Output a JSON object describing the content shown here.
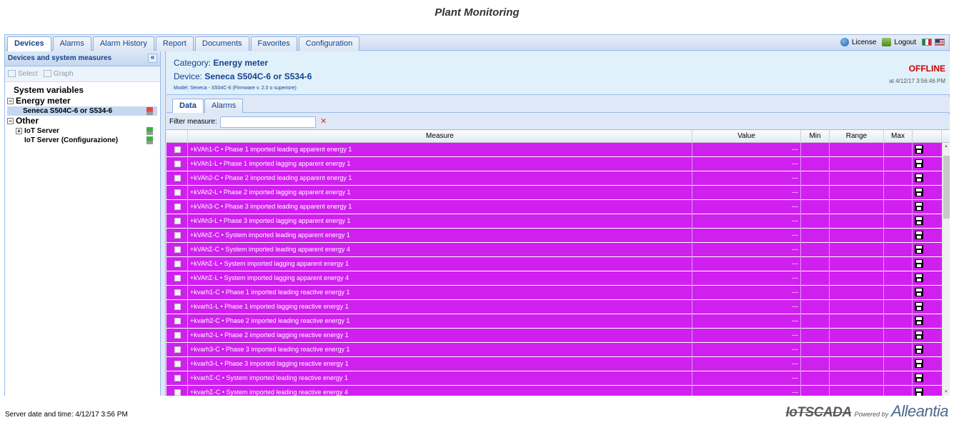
{
  "page": {
    "title": "Plant Monitoring"
  },
  "main_tabs": [
    "Devices",
    "Alarms",
    "Alarm History",
    "Report",
    "Documents",
    "Favorites",
    "Configuration"
  ],
  "top_right": {
    "license_label": "License",
    "logout_label": "Logout"
  },
  "left_panel": {
    "title": "Devices and system measures",
    "collapse_symbol": "«",
    "select_label": "Select",
    "graph_label": "Graph",
    "tree": {
      "system_variables": "System variables",
      "energy_meter": "Energy meter",
      "energy_meter_child": "Seneca S504C-6 or S534-6",
      "other": "Other",
      "iot_server": "IoT Server",
      "iot_server_config": "IoT Server (Configurazione)"
    }
  },
  "device": {
    "category_label": "Category:",
    "category_value": "Energy meter",
    "device_label": "Device:",
    "device_value": "Seneca S504C-6 or S534-6",
    "model": "Model: Seneca - S504C-6 (Firmware v. 2.0 o superiore)",
    "status": "OFFLINE",
    "status_at": "at 4/12/17 3:56:46 PM",
    "status_color": "#cc0000"
  },
  "sub_tabs": [
    "Data",
    "Alarms"
  ],
  "filter": {
    "label": "Filter measure:",
    "value": ""
  },
  "grid": {
    "columns": [
      "Measure",
      "Value",
      "Min",
      "Range",
      "Max"
    ],
    "row_color": "#d020f0",
    "empty_value": "---",
    "rows": [
      "+kVAh1-C • Phase 1 imported leading apparent energy 1",
      "+kVAh1-L • Phase 1 imported lagging apparent energy 1",
      "+kVAh2-C • Phase 2 imported leading apparent energy 1",
      "+kVAh2-L • Phase 2 imported lagging apparent energy 1",
      "+kVAh3-C • Phase 3 imported leading apparent energy 1",
      "+kVAh3-L • Phase 3 imported lagging apparent energy 1",
      "+kVAhΣ-C • System imported leading apparent energy 1",
      "+kVAhΣ-C • System imported leading apparent energy 4",
      "+kVAhΣ-L • System imported lagging apparent energy 1",
      "+kVAhΣ-L • System imported lagging apparent energy 4",
      "+kvarh1-C • Phase 1 imported leading reactive energy 1",
      "+kvarh1-L • Phase 1 imported lagging reactive energy 1",
      "+kvarh2-C • Phase 2 imported leading reactive energy 1",
      "+kvarh2-L • Phase 2 imported lagging reactive energy 1",
      "+kvarh3-C • Phase 3 imported leading reactive energy 1",
      "+kvarh3-L • Phase 3 imported lagging reactive energy 1",
      "+kvarhΣ-C • System imported leading reactive energy 1",
      "+kvarhΣ-C • System imported leading reactive energy 4"
    ]
  },
  "footer": {
    "server_time": "Server date and time: 4/12/17 3:56 PM",
    "brand_product": "IoTSCADA",
    "brand_powered": "Powered by",
    "brand_company": "Alleantia"
  }
}
